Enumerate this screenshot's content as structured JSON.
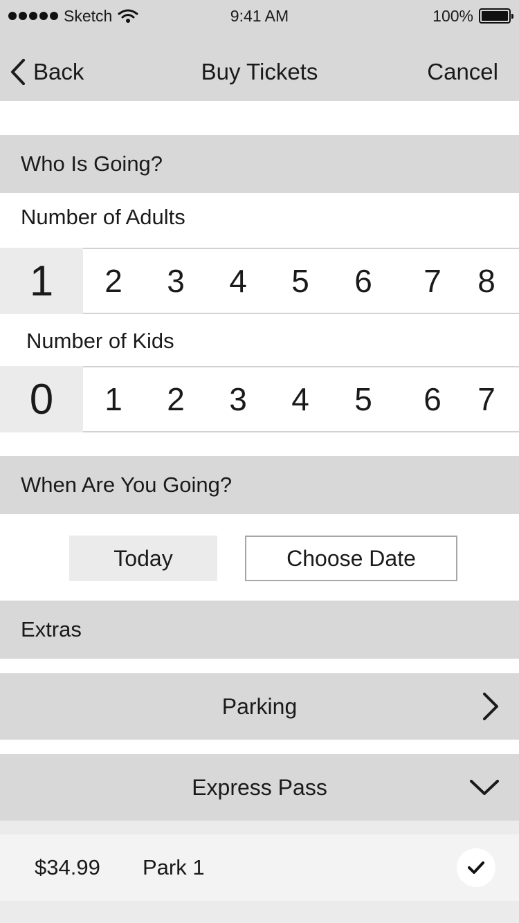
{
  "status": {
    "carrier": "Sketch",
    "time": "9:41 AM",
    "battery": "100%"
  },
  "nav": {
    "back": "Back",
    "title": "Buy Tickets",
    "cancel": "Cancel"
  },
  "who": {
    "header": "Who Is Going?",
    "adults_label": "Number of Adults",
    "adults_selected": "1",
    "adults_options": [
      "2",
      "3",
      "4",
      "5",
      "6",
      "7",
      "8"
    ],
    "kids_label": "Number of Kids",
    "kids_selected": "0",
    "kids_options": [
      "1",
      "2",
      "3",
      "4",
      "5",
      "6",
      "7"
    ]
  },
  "when": {
    "header": "When Are You Going?",
    "today": "Today",
    "choose_date": "Choose Date"
  },
  "extras": {
    "header": "Extras",
    "parking": "Parking",
    "express_pass": "Express Pass",
    "pass_item": {
      "price": "$34.99",
      "name": "Park 1",
      "checked": true
    }
  }
}
